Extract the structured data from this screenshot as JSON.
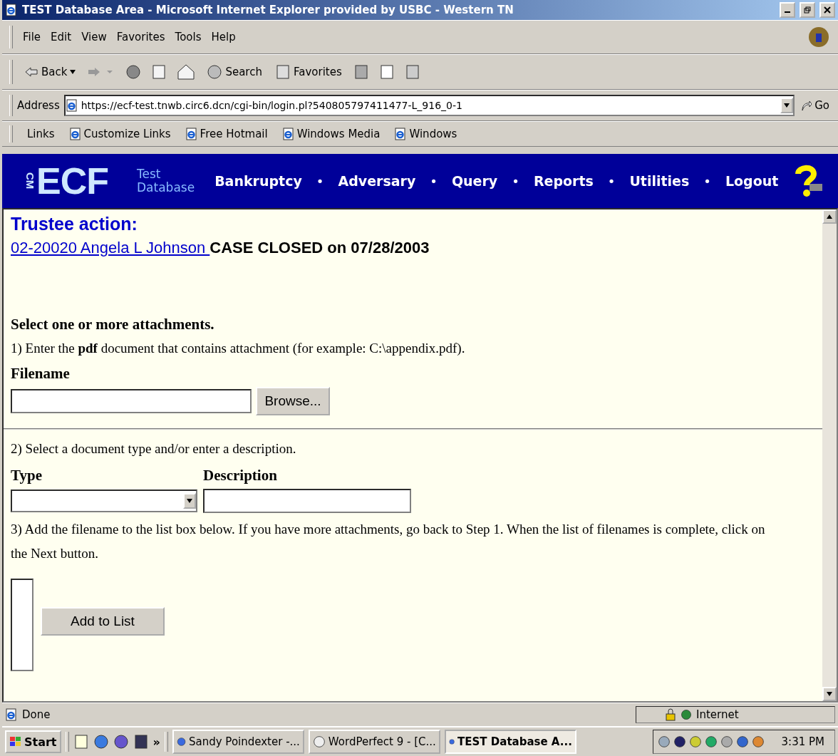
{
  "window": {
    "title": "TEST Database Area - Microsoft Internet Explorer provided by USBC - Western TN"
  },
  "menu": [
    "File",
    "Edit",
    "View",
    "Favorites",
    "Tools",
    "Help"
  ],
  "toolbar": {
    "back": "Back",
    "search": "Search",
    "favorites": "Favorites"
  },
  "address": {
    "label": "Address",
    "url": "https://ecf-test.tnwb.circ6.dcn/cgi-bin/login.pl?540805797411477-L_916_0-1",
    "go": "Go"
  },
  "links": {
    "label": "Links",
    "items": [
      "Customize Links",
      "Free Hotmail",
      "Windows Media",
      "Windows"
    ]
  },
  "nav": {
    "logo_small": "CM",
    "logo": "ECF",
    "subtitle_1": "Test",
    "subtitle_2": "Database",
    "items": [
      {
        "kind": "link",
        "label": "Bankruptcy"
      },
      {
        "kind": "separator",
        "label": "•"
      },
      {
        "kind": "link",
        "label": "Adversary"
      },
      {
        "kind": "separator",
        "label": "•"
      },
      {
        "kind": "link",
        "label": "Query"
      },
      {
        "kind": "separator",
        "label": "•"
      },
      {
        "kind": "link",
        "label": "Reports"
      },
      {
        "kind": "separator",
        "label": "•"
      },
      {
        "kind": "link",
        "label": "Utilities"
      },
      {
        "kind": "separator",
        "label": "•"
      },
      {
        "kind": "link",
        "label": "Logout"
      }
    ]
  },
  "page": {
    "heading": "Trustee action:",
    "case_link": "02-20020 Angela L Johnson ",
    "case_status": "CASE CLOSED on 07/28/2003",
    "prompt": "Select one or more attachments.",
    "step_1": "1) Enter the **pdf** document that contains attachment (for example: C:\\appendix.pdf).",
    "filename_label": "Filename",
    "browse": "Browse...",
    "step_2": "2) Select a document type and/or enter a description.",
    "type_label": "Type",
    "description_label": "Description",
    "step_3": "3) Add the filename to the list box below. If you have more attachments, go back to Step 1. When the list of filenames is complete, click on the Next button.",
    "add_button": "Add to List"
  },
  "status_bar": {
    "text": "Done",
    "zone": "Internet"
  },
  "taskbar": {
    "start": "Start",
    "chevron": "»",
    "tasks": [
      {
        "label": "Sandy Poindexter -...",
        "selected": false
      },
      {
        "label": "WordPerfect 9 - [C...",
        "selected": false
      },
      {
        "label": "TEST Database A...",
        "selected": true
      }
    ],
    "clock": "3:31 PM"
  }
}
